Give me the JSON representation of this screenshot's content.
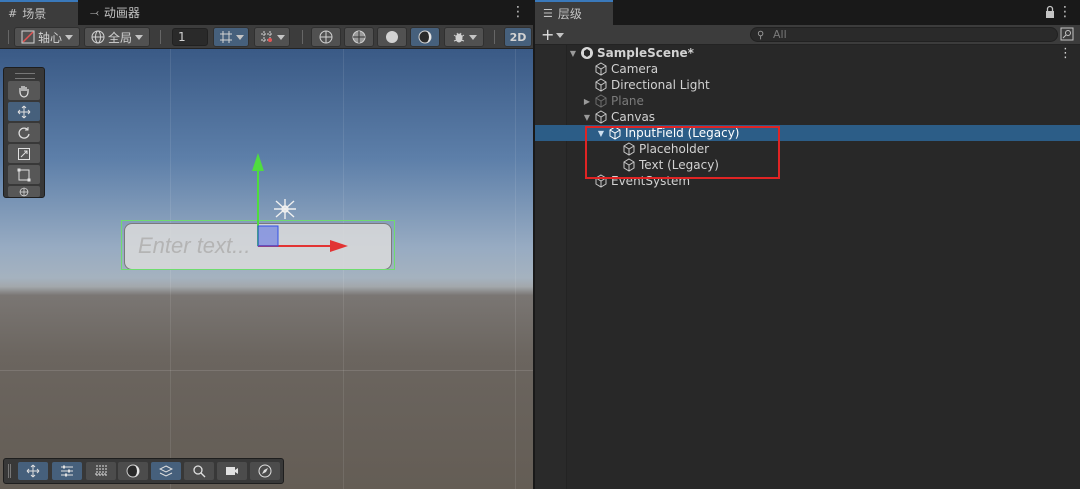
{
  "scene_tabs": {
    "scene_label": "场景",
    "animator_label": "动画器"
  },
  "scene_toolbar": {
    "pivot_label": "轴心",
    "global_label": "全局",
    "grid_value": "1",
    "mode_2d": "2D"
  },
  "viewport": {
    "placeholder_text": "Enter text..."
  },
  "hierarchy": {
    "tab_label": "层级",
    "search_placeholder": "All",
    "scene_name": "SampleScene*",
    "items": [
      {
        "label": "Camera"
      },
      {
        "label": "Directional Light"
      },
      {
        "label": "Plane"
      },
      {
        "label": "Canvas"
      },
      {
        "label": "InputField (Legacy)"
      },
      {
        "label": "Placeholder"
      },
      {
        "label": "Text (Legacy)"
      },
      {
        "label": "EventSystem"
      }
    ]
  },
  "colors": {
    "accent_blue": "#46607c",
    "selection": "#2c5d87",
    "highlight_box": "#e02424",
    "gizmo_green": "#4fdc3f",
    "gizmo_red": "#e23333"
  }
}
